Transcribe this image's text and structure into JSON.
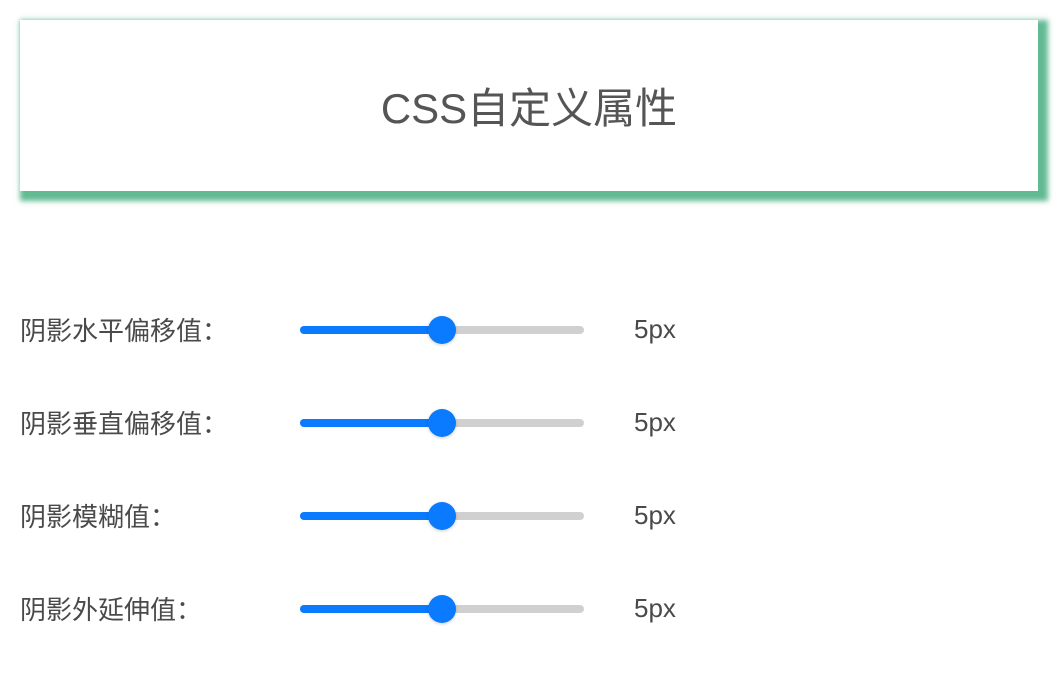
{
  "header": {
    "title": "CSS自定义属性"
  },
  "controls": {
    "horizontal_offset": {
      "label": "阴影水平偏移值：",
      "value": "5px",
      "raw_value": 5
    },
    "vertical_offset": {
      "label": "阴影垂直偏移值：",
      "value": "5px",
      "raw_value": 5
    },
    "blur": {
      "label": "阴影模糊值：",
      "value": "5px",
      "raw_value": 5
    },
    "spread": {
      "label": "阴影外延伸值：",
      "value": "5px",
      "raw_value": 5
    }
  },
  "shadow_color": "rgba(46, 163, 111, 0.75)"
}
